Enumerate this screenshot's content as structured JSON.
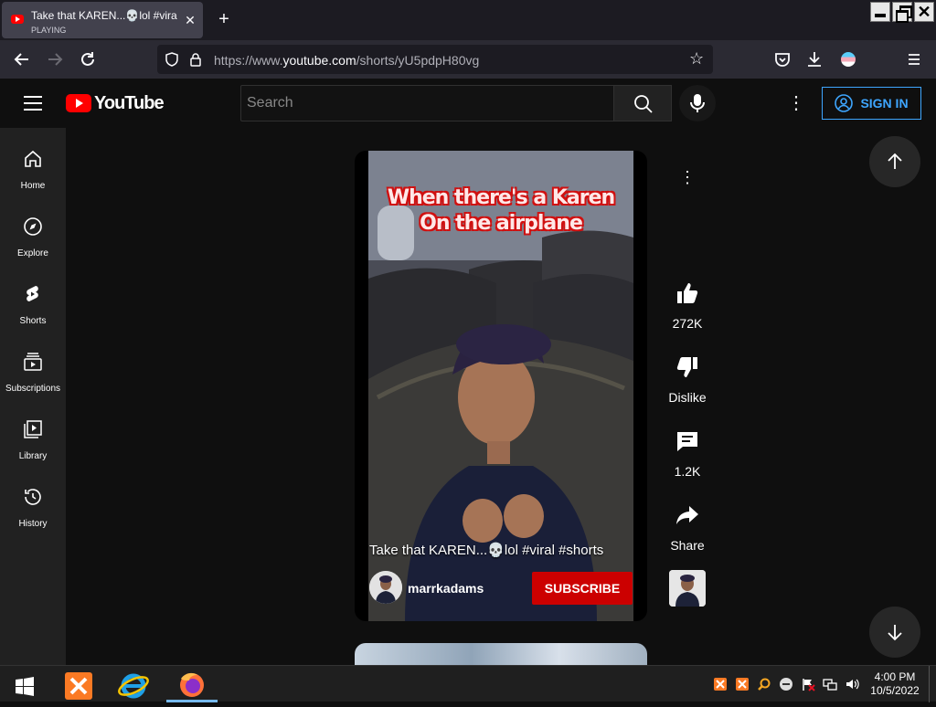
{
  "browser": {
    "tab_title": "Take that KAREN...💀lol #viral #",
    "tab_status": "PLAYING",
    "url_prefix": "https://www.",
    "url_domain": "youtube.com",
    "url_path": "/shorts/yU5pdpH80vg"
  },
  "youtube": {
    "logo_text": "YouTube",
    "search_placeholder": "Search",
    "sign_in_label": "SIGN IN"
  },
  "sidebar": {
    "items": [
      {
        "label": "Home",
        "icon": "home-icon"
      },
      {
        "label": "Explore",
        "icon": "compass-icon"
      },
      {
        "label": "Shorts",
        "icon": "shorts-icon"
      },
      {
        "label": "Subscriptions",
        "icon": "subscriptions-icon"
      },
      {
        "label": "Library",
        "icon": "library-icon"
      },
      {
        "label": "History",
        "icon": "history-icon"
      }
    ]
  },
  "short": {
    "caption_line1": "When there's a Karen",
    "caption_line2": "On the airplane",
    "title": "Take that KAREN...💀lol #viral #shorts",
    "channel": "marrkadams",
    "subscribe_label": "SUBSCRIBE",
    "likes": "272K",
    "dislike_label": "Dislike",
    "comments": "1.2K",
    "share_label": "Share"
  },
  "taskbar": {
    "time": "4:00 PM",
    "date": "10/5/2022"
  },
  "colors": {
    "youtube_red": "#ff0000",
    "subscribe_red": "#cc0000",
    "sign_in_blue": "#3ea6ff"
  }
}
